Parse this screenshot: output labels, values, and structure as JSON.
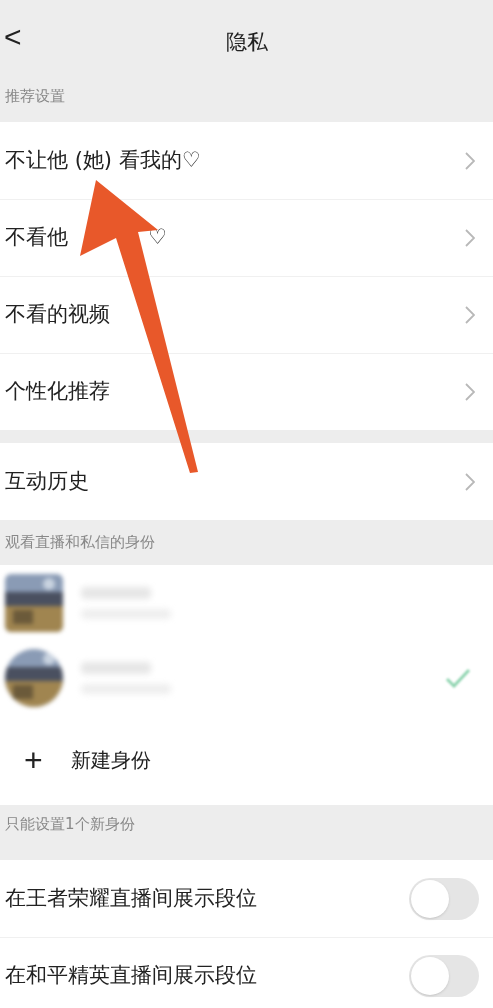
{
  "header": {
    "back": "<",
    "title": "隐私"
  },
  "sections": [
    {
      "title": "推荐设置",
      "rows": [
        {
          "label": "不让他 (她) 看我的♡"
        },
        {
          "label": "不看他",
          "suffix": "♡"
        },
        {
          "label": "不看的视频"
        },
        {
          "label": "个性化推荐"
        }
      ]
    },
    {
      "rows": [
        {
          "label": "互动历史"
        }
      ]
    }
  ],
  "identity_section": {
    "title": "观看直播和私信的身份",
    "identities": [
      {
        "kind": "square",
        "selected": false
      },
      {
        "kind": "round",
        "selected": true
      }
    ],
    "new_identity": {
      "icon": "+",
      "label": "新建身份"
    },
    "note": "只能设置1个新身份"
  },
  "toggles": [
    {
      "label": "在王者荣耀直播间展示段位",
      "on": false
    },
    {
      "label": "在和平精英直播间展示段位",
      "on": false
    }
  ]
}
